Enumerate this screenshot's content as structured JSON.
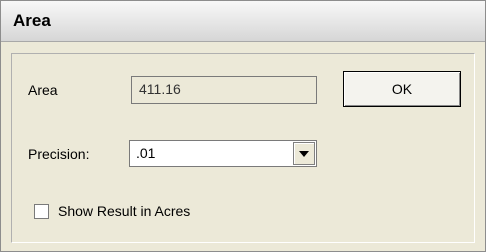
{
  "window": {
    "title": "Area"
  },
  "area": {
    "label": "Area",
    "value": "411.16"
  },
  "buttons": {
    "ok_label": "OK"
  },
  "precision": {
    "label": "Precision:",
    "selected": ".01"
  },
  "options": {
    "show_acres_label": "Show Result in Acres",
    "show_acres_checked": false
  },
  "icons": {
    "dropdown": "chevron-down-icon"
  }
}
